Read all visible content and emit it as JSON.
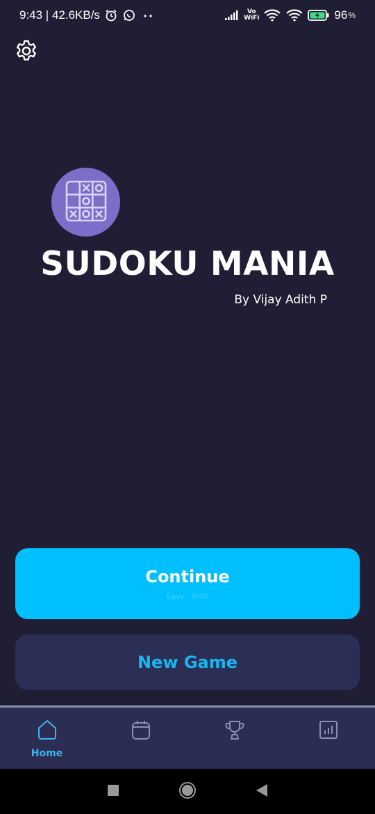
{
  "status_bar": {
    "time_speed": "9:43 | 42.6KB/s",
    "vowifi_top": "Vo",
    "vowifi_bottom": "WiFi",
    "battery_percent": "96",
    "battery_unit": "%",
    "icons": [
      "alarm-icon",
      "whatsapp-icon",
      "more-dots-icon",
      "signal-icon",
      "wifi-icon",
      "wifi-icon",
      "battery-charging-icon"
    ]
  },
  "header": {
    "settings_icon": "gear-icon"
  },
  "hero": {
    "logo_icon": "tic-tac-toe-grid-icon",
    "title": "SUDOKU MANIA",
    "author": "By Vijay Adith P"
  },
  "actions": {
    "continue_label": "Continue",
    "continue_sub": "Easy · 0:00",
    "new_game_label": "New Game"
  },
  "bottom_nav": {
    "items": [
      {
        "label": "Home",
        "icon": "home-icon",
        "active": true
      },
      {
        "label": "",
        "icon": "calendar-icon",
        "active": false
      },
      {
        "label": "",
        "icon": "trophy-icon",
        "active": false
      },
      {
        "label": "",
        "icon": "statistics-icon",
        "active": false
      }
    ]
  },
  "system_nav": {
    "icons": [
      "recents-square-icon",
      "home-circle-icon",
      "back-triangle-icon"
    ]
  },
  "colors": {
    "background": "#1f1e34",
    "accent": "#00bfff",
    "secondary_button": "#2c2f55",
    "logo_circle": "#7b6ec9",
    "nav_active": "#3fb2f2"
  }
}
